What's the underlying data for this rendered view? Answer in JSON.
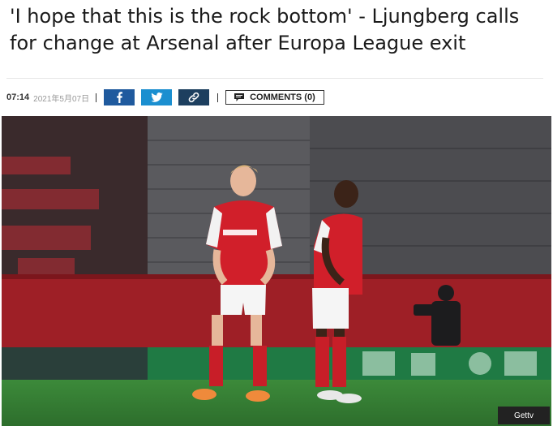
{
  "article": {
    "title": "'I hope that this is the rock bottom' - Ljungberg calls for change at Arsenal after Europa League exit",
    "time": "07:14",
    "date": "2021年5月07日"
  },
  "share": {
    "facebook_icon": "facebook-icon",
    "twitter_icon": "twitter-icon",
    "link_icon": "link-icon"
  },
  "comments": {
    "label": "COMMENTS (0)"
  },
  "photo": {
    "credit": "Gettv"
  },
  "colors": {
    "facebook": "#1f5a9e",
    "twitter": "#1b8fd0",
    "link": "#1d3f5f",
    "arsenal_red": "#d11f2a"
  }
}
